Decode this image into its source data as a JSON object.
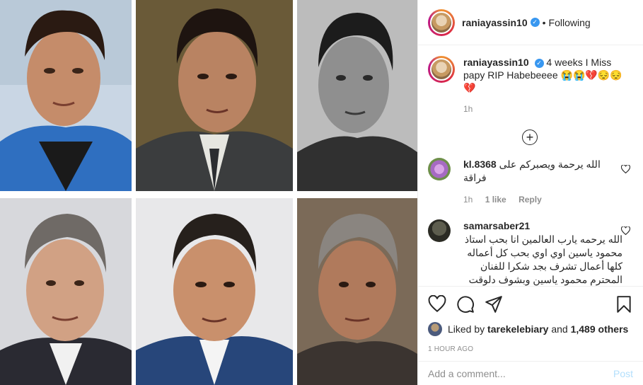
{
  "post": {
    "username": "raniayassin10",
    "follow_status": "Following",
    "separator": "•",
    "verified_mark": "✓",
    "caption": "4 weeks I Miss papy RIP Habebeeee 😭😭💔😔😔💔",
    "caption_age": "1h",
    "add_more_icon": "+",
    "likes_avatar_user": "tarekelebiary",
    "likes_prefix": "Liked by",
    "likes_conj": "and",
    "likes_count": "1,489 others",
    "timestamp": "1 HOUR AGO"
  },
  "comments": [
    {
      "username": "kl.8368",
      "text": "الله يرحمة ويصبركم على فراقة",
      "age": "1h",
      "likes": "1 like",
      "reply_label": "Reply",
      "avatar": "flower"
    },
    {
      "username": "samarsaber21",
      "text": "الله يرحمه يارب العالمين انا بحب استاذ محمود ياسين اوي اوي بحب كل أعماله كلها أعمال تشرف بجد شكرا للفنان المحترم محمود ياسين وبشوف دلوقت مسلسل اللقاء الثاني علي التليفزيون مسلسل بجد جميل 😍😍",
      "avatar": "dark"
    }
  ],
  "comment_input": {
    "placeholder": "Add a comment...",
    "post_label": "Post"
  },
  "icons": [
    "heart-icon",
    "comment-icon",
    "share-icon",
    "bookmark-icon",
    "add-icon"
  ]
}
